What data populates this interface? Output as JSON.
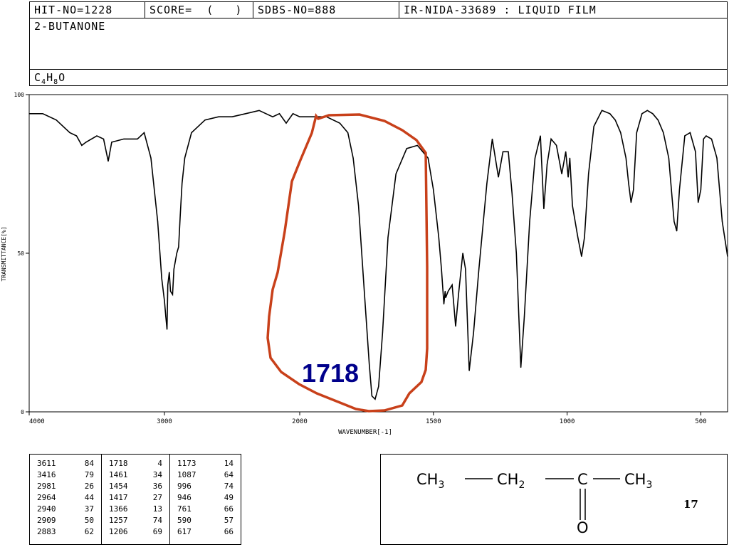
{
  "header": {
    "hit_no": "HIT-NO=1228",
    "score": "SCORE=  (   )",
    "sdbs_no": "SDBS-NO=888",
    "ir_nida": "IR-NIDA-33689 : LIQUID FILM",
    "compound_name": "2-BUTANONE",
    "formula": {
      "c": "C",
      "c_n": "4",
      "h": "H",
      "h_n": "8",
      "o": "O"
    }
  },
  "chart_data": {
    "type": "line",
    "xlabel": "WAVENUMBER[-1]",
    "ylabel": "TRANSMITTANCE[%]",
    "xlim": [
      4000,
      400
    ],
    "ylim": [
      0,
      100
    ],
    "x_ticks": [
      {
        "value": 4000,
        "label": "4000"
      },
      {
        "value": 3000,
        "label": "3000"
      },
      {
        "value": 2000,
        "label": "2000"
      },
      {
        "value": 1500,
        "label": "1500"
      },
      {
        "value": 1000,
        "label": "1000"
      },
      {
        "value": 500,
        "label": "500"
      }
    ],
    "y_ticks": [
      {
        "value": 100,
        "label": "100"
      },
      {
        "value": 50,
        "label": "50"
      },
      {
        "value": 0,
        "label": "0"
      }
    ],
    "annotation": {
      "text": "1718",
      "color": "#00008B",
      "highlight_color": "#C8401A"
    },
    "line_color": "#000000",
    "x": [
      4000,
      3900,
      3800,
      3700,
      3650,
      3611,
      3580,
      3500,
      3450,
      3416,
      3390,
      3300,
      3200,
      3150,
      3100,
      3050,
      3020,
      3000,
      2990,
      2981,
      2975,
      2964,
      2955,
      2940,
      2930,
      2909,
      2895,
      2883,
      2870,
      2850,
      2800,
      2700,
      2600,
      2500,
      2400,
      2300,
      2200,
      2150,
      2100,
      2050,
      2000,
      1950,
      1900,
      1850,
      1820,
      1800,
      1780,
      1760,
      1740,
      1730,
      1718,
      1705,
      1690,
      1670,
      1640,
      1600,
      1560,
      1520,
      1500,
      1480,
      1470,
      1461,
      1456,
      1454,
      1445,
      1430,
      1417,
      1405,
      1390,
      1380,
      1366,
      1350,
      1330,
      1300,
      1280,
      1257,
      1240,
      1220,
      1206,
      1190,
      1173,
      1160,
      1140,
      1120,
      1100,
      1087,
      1075,
      1060,
      1040,
      1020,
      1005,
      996,
      990,
      980,
      960,
      946,
      935,
      920,
      900,
      870,
      840,
      820,
      800,
      780,
      770,
      761,
      752,
      740,
      720,
      700,
      680,
      660,
      640,
      620,
      610,
      600,
      590,
      580,
      560,
      540,
      520,
      510,
      500,
      490,
      480,
      460,
      440,
      420,
      400
    ],
    "y": [
      94,
      94,
      92,
      88,
      87,
      84,
      85,
      87,
      86,
      79,
      85,
      86,
      86,
      88,
      80,
      60,
      42,
      35,
      30,
      26,
      40,
      44,
      38,
      37,
      45,
      50,
      52,
      62,
      72,
      80,
      88,
      92,
      93,
      93,
      94,
      95,
      93,
      94,
      91,
      94,
      93,
      93,
      93,
      91,
      88,
      80,
      65,
      40,
      15,
      5,
      4,
      8,
      25,
      55,
      75,
      83,
      84,
      80,
      70,
      55,
      45,
      34,
      38,
      36,
      38,
      40,
      27,
      38,
      50,
      45,
      13,
      25,
      45,
      72,
      86,
      74,
      82,
      82,
      69,
      50,
      14,
      30,
      60,
      80,
      87,
      64,
      78,
      86,
      84,
      75,
      82,
      74,
      80,
      65,
      55,
      49,
      55,
      75,
      90,
      95,
      94,
      92,
      88,
      80,
      72,
      66,
      70,
      88,
      94,
      95,
      94,
      92,
      88,
      80,
      70,
      60,
      57,
      70,
      87,
      88,
      82,
      66,
      70,
      86,
      87,
      86,
      80,
      60,
      49
    ]
  },
  "peak_table": {
    "columns": [
      [
        [
          "3611",
          "84"
        ],
        [
          "3416",
          "79"
        ],
        [
          "2981",
          "26"
        ],
        [
          "2964",
          "44"
        ],
        [
          "2940",
          "37"
        ],
        [
          "2909",
          "50"
        ],
        [
          "2883",
          "62"
        ]
      ],
      [
        [
          "1718",
          "4"
        ],
        [
          "1461",
          "34"
        ],
        [
          "1454",
          "36"
        ],
        [
          "1417",
          "27"
        ],
        [
          "1366",
          "13"
        ],
        [
          "1257",
          "74"
        ],
        [
          "1206",
          "69"
        ]
      ],
      [
        [
          "1173",
          "14"
        ],
        [
          "1087",
          "64"
        ],
        [
          "996",
          "74"
        ],
        [
          "946",
          "49"
        ],
        [
          "761",
          "66"
        ],
        [
          "590",
          "57"
        ],
        [
          "617",
          "66"
        ]
      ]
    ]
  },
  "structure": {
    "ch3_left": "CH",
    "sub_3a": "3",
    "ch2": "CH",
    "sub_2": "2",
    "c": "C",
    "ch3_right": "CH",
    "sub_3b": "3",
    "o": "O"
  },
  "slide_number": "17"
}
